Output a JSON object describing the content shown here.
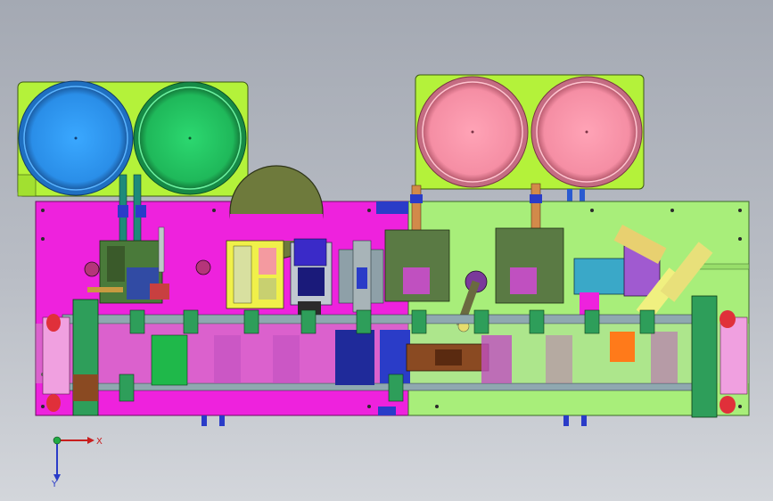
{
  "viewport": {
    "background_top": "#a4a9b3",
    "background_bottom": "#d3d6db",
    "model": "assembly-machine-top-view"
  },
  "colors": {
    "magenta_plate": "#ee22dd",
    "green_plate": "#a8ee7a",
    "lime_panel": "#b4f23a",
    "blue_bowl": "#2a96f0",
    "green_bowl": "#22cc66",
    "pink_bowl": "#ff9aae",
    "olive_disk": "#6e7a3c",
    "rail_gray": "#8aa0a8",
    "block_green": "#2e9e5a",
    "navy_block": "#1f2a9a",
    "brown_block": "#8a4a22",
    "orange_block": "#ff7a1a",
    "red_wheel": "#e0303a"
  },
  "coordinate_triad": {
    "x_label": "X",
    "y_label": "Y",
    "icon": "axis-triad-icon"
  }
}
